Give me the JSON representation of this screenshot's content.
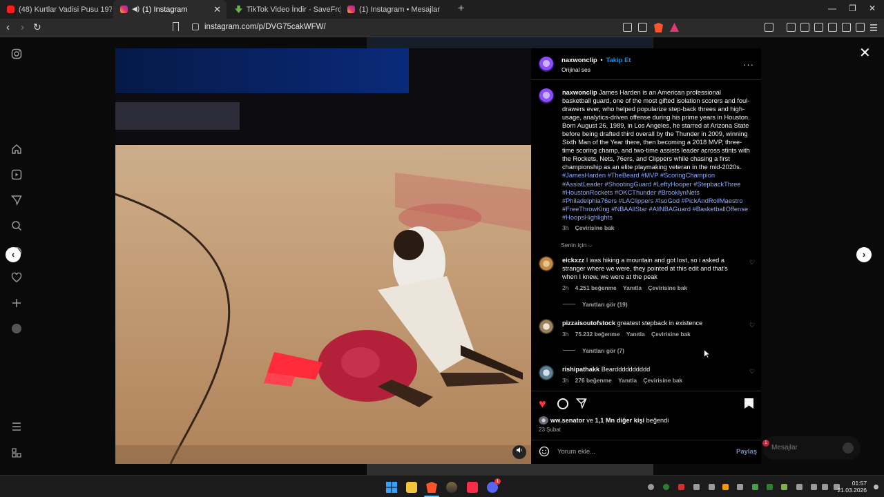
{
  "browser": {
    "tabs": [
      {
        "label": "(48) Kurtlar Vadisi Pusu 197. Bölüm -",
        "favicon": "youtube-icon"
      },
      {
        "label": "(1) Instagram",
        "favicon": "instagram-icon",
        "active": true
      },
      {
        "label": "TikTok Video İndir - SaveFrom ile Üc",
        "favicon": "savefrom-icon"
      },
      {
        "label": "(1) Instagram • Mesajlar",
        "favicon": "instagram-icon"
      }
    ],
    "url": "instagram.com/p/DVG75cakWFW/"
  },
  "post": {
    "author": "naxwonclip",
    "follow_label": "Takip Et",
    "separator": "•",
    "audio": "Orijinal ses",
    "caption_text": "James Harden is an American professional basketball guard, one of the most gifted isolation scorers and foul-drawers ever, who helped popularize step-back threes and high-usage, analytics-driven offense during his prime years in Houston. Born August 26, 1989, in Los Angeles, he starred at Arizona State before being drafted third overall by the Thunder in 2009, winning Sixth Man of the Year there, then becoming a 2018 MVP, three-time scoring champ, and two-time assists leader across stints with the Rockets, Nets, 76ers, and Clippers while chasing a first championship as an elite playmaking veteran in the mid-2020s.",
    "hashtags": "#JamesHarden #TheBeard #MVP #ScoringChampion #AssistLeader #ShootingGuard #LeftyHooper #StepbackThree #HoustonRockets #OKCThunder #BrooklynNets #Philadelphia76ers #LAClippers #IsoGod #PickAndRollMaestro #FreeThrowKing #NBAAllStar #AllNBAGuard #BasketballOffense #HoopsHighlights",
    "caption_time": "3h",
    "translate_label": "Çevirisine bak",
    "sort_label": "Senin için",
    "likes_user": "ww.senator",
    "likes_rest": "ve",
    "likes_count": "1,1 Mn diğer kişi",
    "likes_suffix": "beğendi",
    "date": "23 Şubat",
    "comment_placeholder": "Yorum ekle...",
    "share_label": "Paylaş"
  },
  "comments": [
    {
      "user": "eickxzz",
      "text": "I was hiking a mountain and got lost, so i asked a stranger where we were, they pointed at this edit and that's when I knew, we were at the peak",
      "time": "2h",
      "likes": "4.251 beğenme",
      "reply": "Yanıtla",
      "translate": "Çevirisine bak",
      "view_replies": "Yanıtları gör (19)"
    },
    {
      "user": "pizzaisoutofstock",
      "text": "greatest stepback in existence",
      "time": "3h",
      "likes": "75.232 beğenme",
      "reply": "Yanıtla",
      "translate": "Çevirisine bak",
      "view_replies": "Yanıtları gör (7)"
    },
    {
      "user": "rishipathakk",
      "text": "Beardddddddddd",
      "time": "3h",
      "likes": "276 beğenme",
      "reply": "Yanıtla",
      "translate": "Çevirisine bak"
    }
  ],
  "background": {
    "messages_label": "Mesajlar",
    "messages_badge": "1"
  },
  "taskbar": {
    "time": "01:57",
    "date": "21.03.2026",
    "discord_badge": "1"
  },
  "colors": {
    "accent_blue": "#0095f6",
    "like_red": "#ff3040",
    "hashtag": "#8ea8ff"
  }
}
